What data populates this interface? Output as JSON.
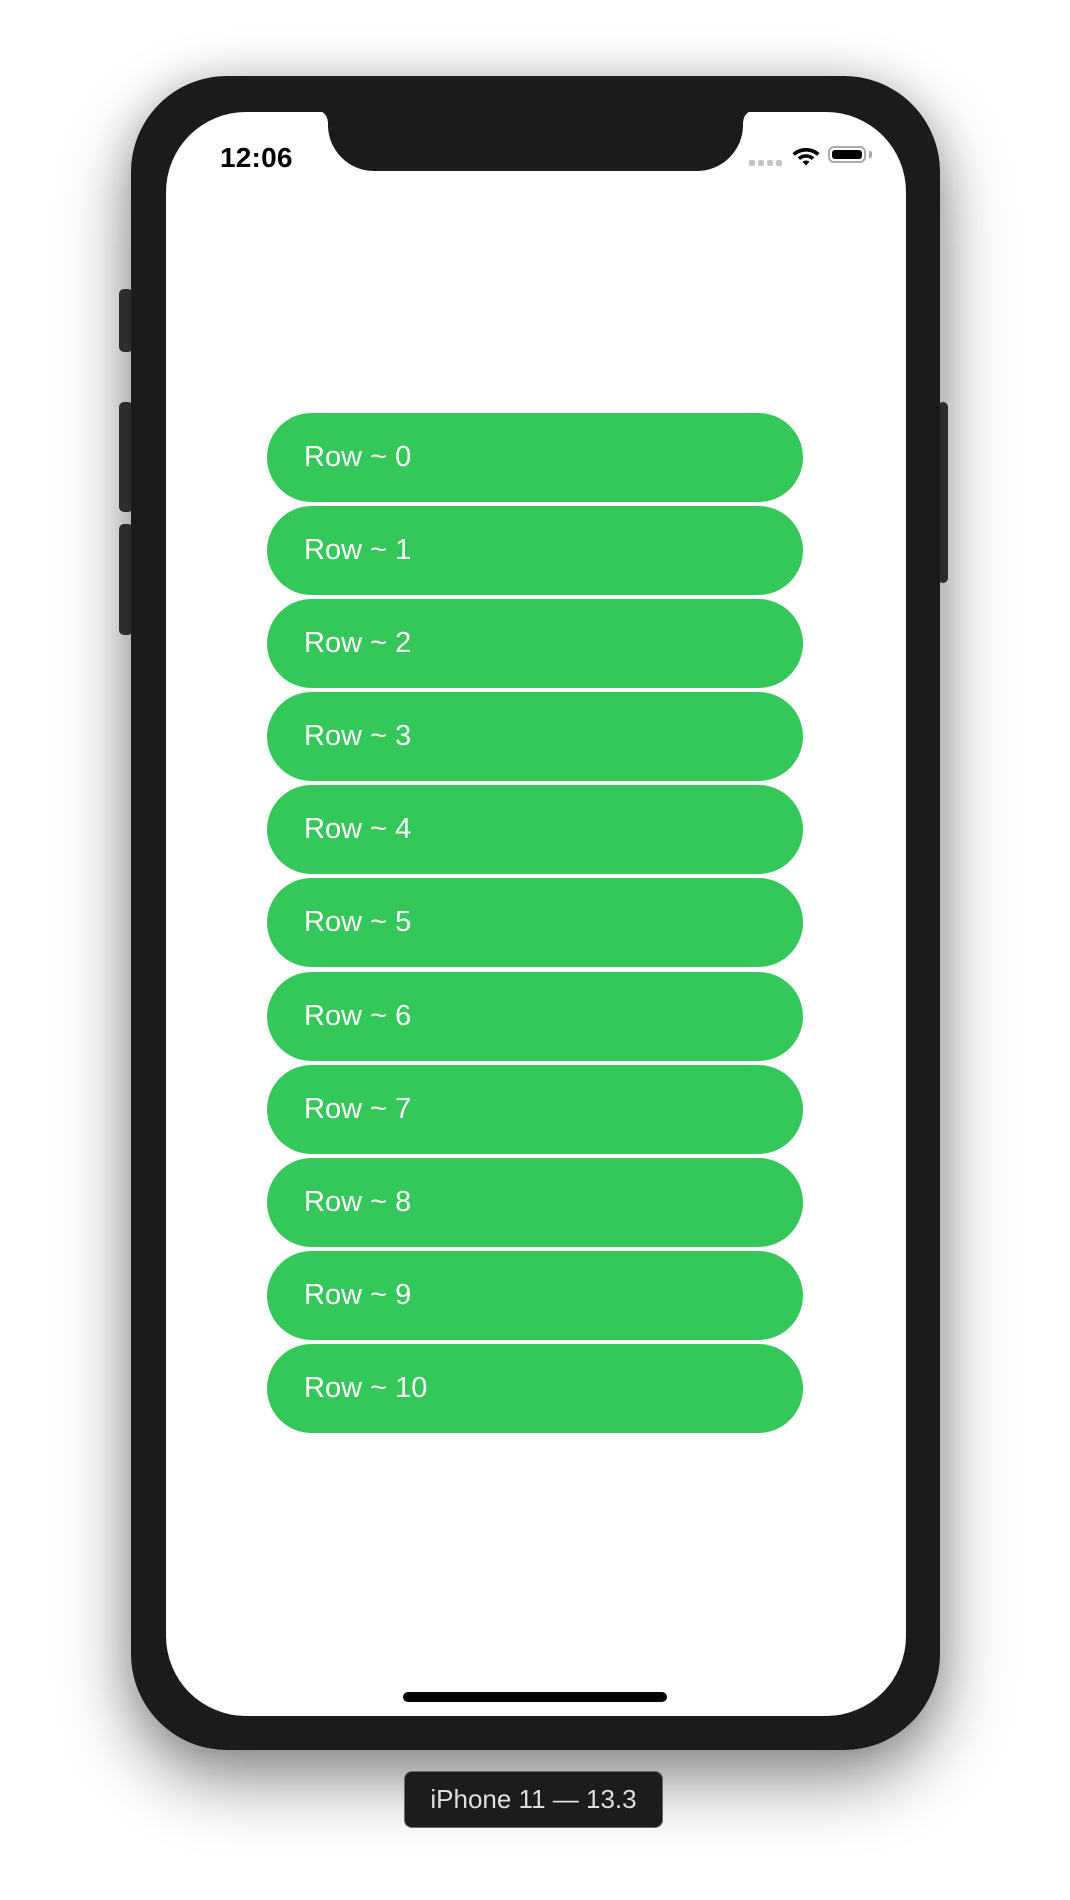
{
  "status_bar": {
    "time": "12:06",
    "signal_icon": "cellular-signal-icon",
    "wifi_icon": "wifi-icon",
    "battery_icon": "battery-icon",
    "battery_level": 1.0
  },
  "list": {
    "accent_color": "#34C759",
    "rows": [
      {
        "label": "Row ~ 0"
      },
      {
        "label": "Row ~ 1"
      },
      {
        "label": "Row ~ 2"
      },
      {
        "label": "Row ~ 3"
      },
      {
        "label": "Row ~ 4"
      },
      {
        "label": "Row ~ 5"
      },
      {
        "label": "Row ~ 6"
      },
      {
        "label": "Row ~ 7"
      },
      {
        "label": "Row ~ 8"
      },
      {
        "label": "Row ~ 9"
      },
      {
        "label": "Row ~ 10"
      }
    ]
  },
  "simulator": {
    "device_label": "iPhone 11 — 13.3"
  }
}
